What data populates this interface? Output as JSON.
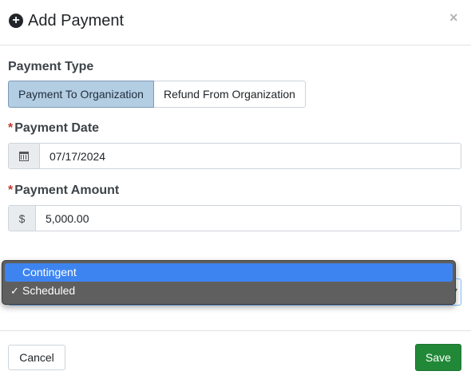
{
  "modal": {
    "title": "Add Payment",
    "title_icon": "plus-circle-icon",
    "close_label": "×"
  },
  "payment_type": {
    "label": "Payment Type",
    "options": [
      "Payment To Organization",
      "Refund From Organization"
    ],
    "selected": "Payment To Organization"
  },
  "payment_date": {
    "required_mark": "*",
    "label": "Payment Date",
    "icon": "calendar-icon",
    "value": "07/17/2024"
  },
  "payment_amount": {
    "required_mark": "*",
    "label": "Payment Amount",
    "prefix": "$",
    "value": "5,000.00"
  },
  "status_dropdown": {
    "options": [
      "Contingent",
      "Scheduled"
    ],
    "highlighted": "Contingent",
    "checked": "Scheduled",
    "check_mark": "✓"
  },
  "footer": {
    "cancel_label": "Cancel",
    "save_label": "Save"
  },
  "colors": {
    "active_segment": "#b3cde3",
    "save_button": "#218838",
    "dropdown_highlight": "#3d84f1",
    "required": "#c0392b"
  }
}
